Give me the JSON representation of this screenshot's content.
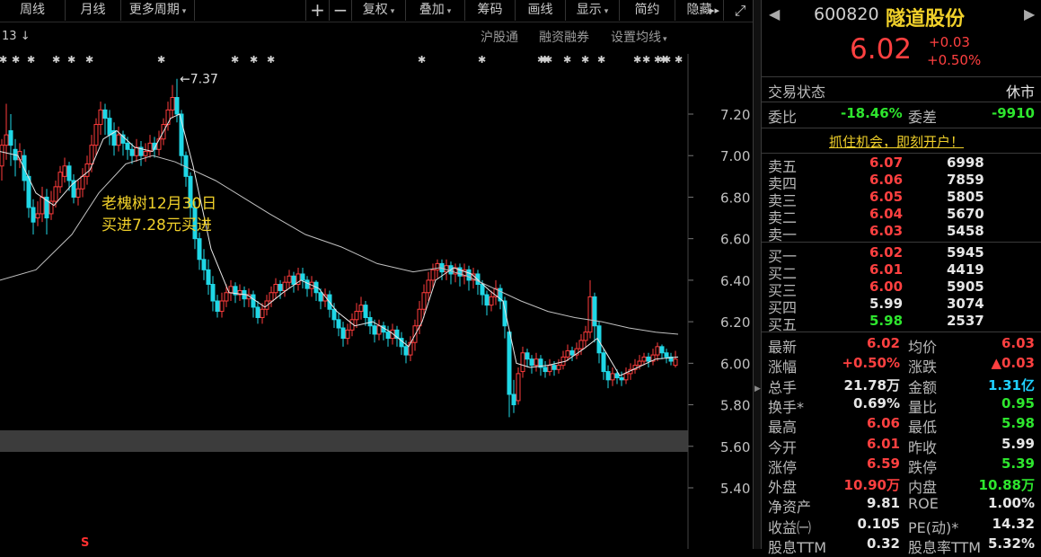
{
  "toolbar": {
    "items": [
      {
        "label": "周线",
        "dropdown": false
      },
      {
        "label": "月线",
        "dropdown": false
      },
      {
        "label": "更多周期",
        "dropdown": true
      },
      {
        "label": "+",
        "dropdown": false
      },
      {
        "label": "−",
        "dropdown": false
      },
      {
        "label": "复权",
        "dropdown": true
      },
      {
        "label": "叠加",
        "dropdown": true
      },
      {
        "label": "筹码",
        "dropdown": false
      },
      {
        "label": "画线",
        "dropdown": false
      },
      {
        "label": "显示",
        "dropdown": true
      },
      {
        "label": "简约",
        "dropdown": false
      },
      {
        "label": "隐藏",
        "dropdown": false
      }
    ],
    "more_glyph": "▸▸",
    "fullscreen_glyph": "⤢"
  },
  "chart": {
    "top_left_label": "13",
    "top_left_arrow": "↓",
    "links": [
      "沪股通",
      "融资融券",
      "设置均线"
    ],
    "peak_label": "←7.37",
    "annotation_line1": "老槐树12月30日",
    "annotation_line2": "买进7.28元买进",
    "bottom_marker": "S",
    "colors": {
      "up": "#ff3b3b",
      "down": "#1fd7e6",
      "ma_white": "#e8e8e8",
      "ma_gray": "#c0c0c0",
      "annotation": "#f0d02a"
    }
  },
  "chart_data": {
    "type": "candlestick",
    "y_ticks": [
      "7.20",
      "7.00",
      "6.80",
      "6.60",
      "6.40",
      "6.20",
      "6.00",
      "5.80",
      "5.60",
      "5.40"
    ],
    "ylim": [
      5.35,
      7.42
    ],
    "peak_value": 7.37
  },
  "panel": {
    "code": "600820",
    "name": "隧道股份",
    "price": "6.02",
    "change": "+0.03",
    "change_pct": "+0.50%",
    "trade_status_label": "交易状态",
    "trade_status_value": "休市",
    "weibi_label": "委比",
    "weibi_value": "-18.46%",
    "weicha_label": "委差",
    "weicha_value": "-9910",
    "promo": "抓住机会，即刻开户！",
    "asks": [
      {
        "label": "卖五",
        "price": "6.07",
        "vol": "6998"
      },
      {
        "label": "卖四",
        "price": "6.06",
        "vol": "7859"
      },
      {
        "label": "卖三",
        "price": "6.05",
        "vol": "5805"
      },
      {
        "label": "卖二",
        "price": "6.04",
        "vol": "5670"
      },
      {
        "label": "卖一",
        "price": "6.03",
        "vol": "5458"
      }
    ],
    "bids": [
      {
        "label": "买一",
        "price": "6.02",
        "vol": "5945"
      },
      {
        "label": "买二",
        "price": "6.01",
        "vol": "4419"
      },
      {
        "label": "买三",
        "price": "6.00",
        "vol": "5905"
      },
      {
        "label": "买四",
        "price": "5.99",
        "vol": "3074"
      },
      {
        "label": "买五",
        "price": "5.98",
        "vol": "2537"
      }
    ],
    "quotes": [
      {
        "l1": "最新",
        "v1": "6.02",
        "c1": "red",
        "l2": "均价",
        "v2": "6.03",
        "c2": "red"
      },
      {
        "l1": "涨幅",
        "v1": "+0.50%",
        "c1": "red",
        "l2": "涨跌",
        "v2": "▲0.03",
        "c2": "red"
      },
      {
        "l1": "总手",
        "v1": "21.78万",
        "c1": "white",
        "l2": "金额",
        "v2": "1.31亿",
        "c2": "cyan"
      },
      {
        "l1": "换手*",
        "v1": "0.69%",
        "c1": "white",
        "l2": "量比",
        "v2": "0.95",
        "c2": "green"
      },
      {
        "l1": "最高",
        "v1": "6.06",
        "c1": "red",
        "l2": "最低",
        "v2": "5.98",
        "c2": "green"
      },
      {
        "l1": "今开",
        "v1": "6.01",
        "c1": "red",
        "l2": "昨收",
        "v2": "5.99",
        "c2": "white"
      },
      {
        "l1": "涨停",
        "v1": "6.59",
        "c1": "red",
        "l2": "跌停",
        "v2": "5.39",
        "c2": "green"
      },
      {
        "l1": "外盘",
        "v1": "10.90万",
        "c1": "red",
        "l2": "内盘",
        "v2": "10.88万",
        "c2": "green"
      },
      {
        "l1": "净资产",
        "v1": "9.81",
        "c1": "white",
        "l2": "ROE",
        "v2": "1.00%",
        "c2": "white"
      },
      {
        "l1": "收益㈠",
        "v1": "0.105",
        "c1": "white",
        "l2": "PE(动)*",
        "v2": "14.32",
        "c2": "white"
      },
      {
        "l1": "股息TTM",
        "v1": "0.32",
        "c1": "white",
        "l2": "股息率TTM",
        "v2": "5.32%",
        "c2": "white"
      }
    ]
  }
}
